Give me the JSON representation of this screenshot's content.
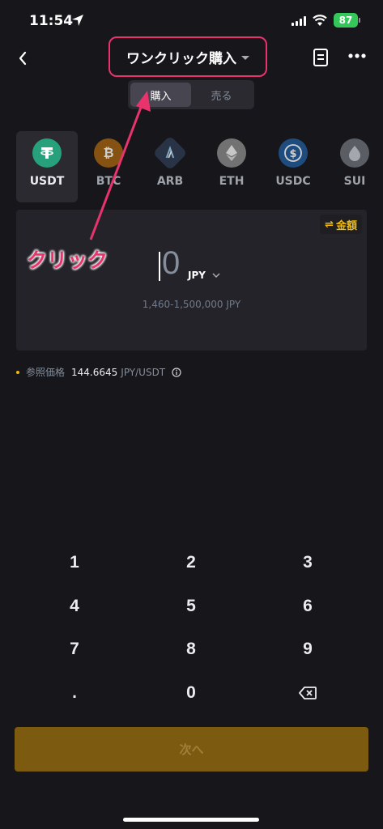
{
  "status_bar": {
    "time": "11:54",
    "battery": "87"
  },
  "header": {
    "title": "ワンクリック購入"
  },
  "toggle": {
    "buy_label": "購入",
    "sell_label": "売る"
  },
  "coins": [
    {
      "symbol": "USDT",
      "icon": "tether-icon",
      "color": "#26a17b"
    },
    {
      "symbol": "BTC",
      "icon": "bitcoin-icon",
      "color": "#f7931a"
    },
    {
      "symbol": "ARB",
      "icon": "arbitrum-icon",
      "color": "#28a0f0"
    },
    {
      "symbol": "ETH",
      "icon": "ethereum-icon",
      "color": "#8a8a8a"
    },
    {
      "symbol": "USDC",
      "icon": "usdc-icon",
      "color": "#2775ca"
    },
    {
      "symbol": "SUI",
      "icon": "sui-icon",
      "color": "#6fbcf0"
    }
  ],
  "amount": {
    "switch_label": "金額",
    "value": "0",
    "currency": "JPY",
    "range": "1,460-1,500,000 JPY"
  },
  "reference": {
    "label": "参照価格",
    "value": "144.6645",
    "unit": "JPY/USDT"
  },
  "annotation": {
    "text": "クリック"
  },
  "keypad": [
    "1",
    "2",
    "3",
    "4",
    "5",
    "6",
    "7",
    "8",
    "9",
    ".",
    "0"
  ],
  "next_button": "次へ",
  "colors": {
    "accent": "#f0b90b",
    "annotation": "#e8336d",
    "background": "#17161a"
  }
}
